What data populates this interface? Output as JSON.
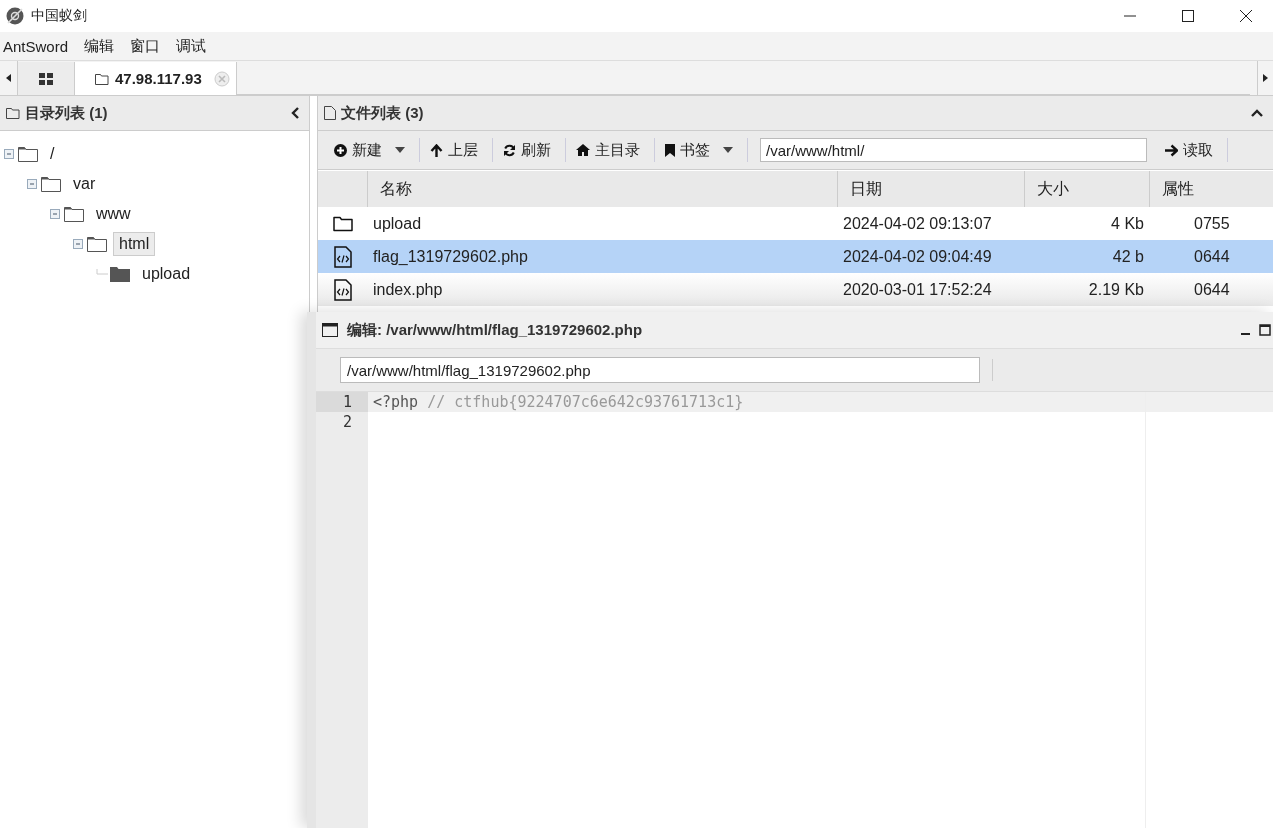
{
  "window": {
    "title": "中国蚁剑"
  },
  "menu": [
    "AntSword",
    "编辑",
    "窗口",
    "调试"
  ],
  "tabs": [
    {
      "kind": "home",
      "selected": false
    },
    {
      "kind": "shell",
      "label": "47.98.117.93",
      "selected": true
    }
  ],
  "directory_panel": {
    "title": "目录列表 (1)",
    "tree": [
      {
        "name": "/",
        "expanded": true,
        "selected": false,
        "children": [
          {
            "name": "var",
            "expanded": true,
            "selected": false,
            "children": [
              {
                "name": "www",
                "expanded": true,
                "selected": false,
                "children": [
                  {
                    "name": "html",
                    "expanded": true,
                    "selected": true,
                    "children": [
                      {
                        "name": "upload",
                        "selected": false
                      }
                    ]
                  }
                ]
              }
            ]
          }
        ]
      }
    ]
  },
  "file_panel": {
    "title": "文件列表 (3)",
    "toolbar": [
      {
        "kind": "plus",
        "label": "新建",
        "dropdown": true
      },
      {
        "kind": "up",
        "label": "上层",
        "dropdown": false
      },
      {
        "kind": "refresh",
        "label": "刷新",
        "dropdown": false
      },
      {
        "kind": "home",
        "label": "主目录",
        "dropdown": false
      },
      {
        "kind": "bookmark",
        "label": "书签",
        "dropdown": true
      }
    ],
    "path": "/var/www/html/",
    "read_button": "读取",
    "columns": [
      "名称",
      "日期",
      "大小",
      "属性"
    ],
    "rows": [
      {
        "kind": "folder",
        "name": "upload",
        "date": "2024-04-02 09:13:07",
        "size": "4 Kb",
        "mode": "0755",
        "selected": false
      },
      {
        "kind": "code",
        "name": "flag_1319729602.php",
        "date": "2024-04-02 09:04:49",
        "size": "42 b",
        "mode": "0644",
        "selected": true
      },
      {
        "kind": "code",
        "name": "index.php",
        "date": "2020-03-01 17:52:24",
        "size": "2.19 Kb",
        "mode": "0644",
        "selected": false
      }
    ]
  },
  "editor": {
    "title": "编辑: /var/www/html/flag_1319729602.php",
    "path": "/var/www/html/flag_1319729602.php",
    "lines": [
      {
        "number": "1",
        "active": true,
        "tokens": [
          {
            "kind": "keyword",
            "text": "<?php"
          },
          {
            "kind": "comment",
            "text": " // ctfhub{9224707c6e642c93761713c1}"
          }
        ]
      },
      {
        "number": "2",
        "active": false
      }
    ]
  }
}
